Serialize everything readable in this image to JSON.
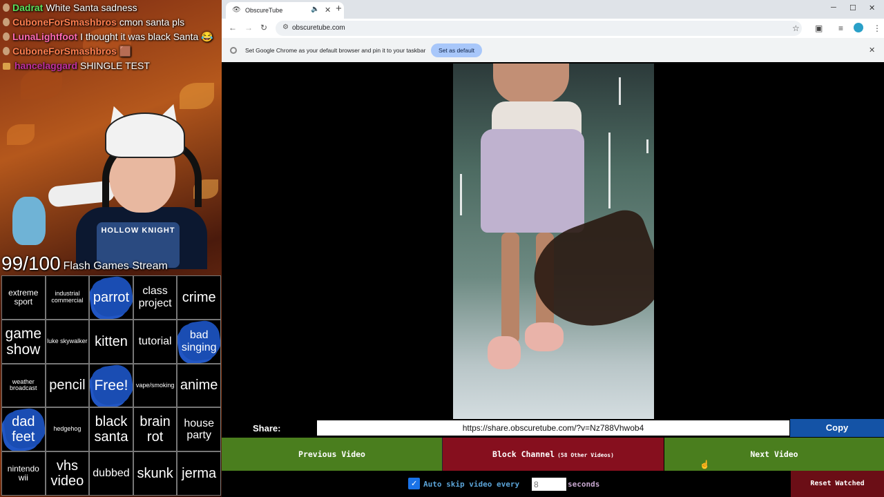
{
  "chat": [
    {
      "user": "Dadrat",
      "color": "#5be05b",
      "text": "White Santa sadness"
    },
    {
      "user": "CuboneForSmashbros",
      "color": "#ff7f50",
      "text": "cmon santa pls"
    },
    {
      "user": "LunaLightfoot",
      "color": "#ff69b4",
      "text": "I thought it was black Santa 😂"
    },
    {
      "user": "CuboneForSmashbros",
      "color": "#ff7f50",
      "text": "🟫"
    },
    {
      "user": "hancelaggard",
      "color": "#c030a0",
      "text": "SHINGLE TEST"
    }
  ],
  "stream": {
    "counter": "99/100",
    "stream_title": "Flash Games Stream",
    "shirt_text": "HOLLOW KNIGHT"
  },
  "bingo": [
    {
      "text": "extreme sport",
      "marked": false,
      "size": "s-sm"
    },
    {
      "text": "industrial commercial",
      "marked": false,
      "size": "s-xs"
    },
    {
      "text": "parrot",
      "marked": true,
      "size": "s-lg"
    },
    {
      "text": "class project",
      "marked": false,
      "size": "s-md"
    },
    {
      "text": "crime",
      "marked": false,
      "size": "s-lg"
    },
    {
      "text": "game show",
      "marked": false,
      "size": "s-xl"
    },
    {
      "text": "luke skywalker",
      "marked": false,
      "size": "s-xs"
    },
    {
      "text": "kitten",
      "marked": false,
      "size": "s-lg"
    },
    {
      "text": "tutorial",
      "marked": false,
      "size": "s-md"
    },
    {
      "text": "bad singing",
      "marked": true,
      "size": "s-md"
    },
    {
      "text": "weather broadcast",
      "marked": false,
      "size": "s-xs"
    },
    {
      "text": "pencil",
      "marked": false,
      "size": "s-lg"
    },
    {
      "text": "Free!",
      "marked": true,
      "size": "s-xl"
    },
    {
      "text": "vape/smoking",
      "marked": false,
      "size": "s-xs"
    },
    {
      "text": "anime",
      "marked": false,
      "size": "s-lg"
    },
    {
      "text": "dad feet",
      "marked": true,
      "size": "s-lg"
    },
    {
      "text": "hedgehog",
      "marked": false,
      "size": "s-xs"
    },
    {
      "text": "black santa",
      "marked": false,
      "size": "s-lg"
    },
    {
      "text": "brain rot",
      "marked": false,
      "size": "s-lg"
    },
    {
      "text": "house party",
      "marked": false,
      "size": "s-md"
    },
    {
      "text": "nintendo wii",
      "marked": false,
      "size": "s-sm"
    },
    {
      "text": "vhs video",
      "marked": false,
      "size": "s-lg"
    },
    {
      "text": "dubbed",
      "marked": false,
      "size": "s-md"
    },
    {
      "text": "skunk",
      "marked": false,
      "size": "s-lg"
    },
    {
      "text": "jerma",
      "marked": false,
      "size": "s-lg"
    }
  ],
  "browser": {
    "tab_title": "ObscureTube",
    "tab_favicon": "eye-icon",
    "url": "obscuretube.com",
    "infobar_text": "Set Google Chrome as your default browser and pin it to your taskbar",
    "infobar_button": "Set as default",
    "win_min": "─",
    "win_max": "☐",
    "win_close": "✕"
  },
  "page": {
    "share_label": "Share:",
    "share_url": "https://share.obscuretube.com/?v=Nz788Vhwob4",
    "copy_label": "Copy",
    "prev_label": "Previous Video",
    "block_label": "Block Channel",
    "block_sub": "(58 Other Videos)",
    "next_label": "Next Video",
    "auto_text": "Auto skip video every",
    "auto_checked": true,
    "seconds_placeholder": "8",
    "seconds_text": "seconds",
    "reset_label": "Reset Watched"
  }
}
